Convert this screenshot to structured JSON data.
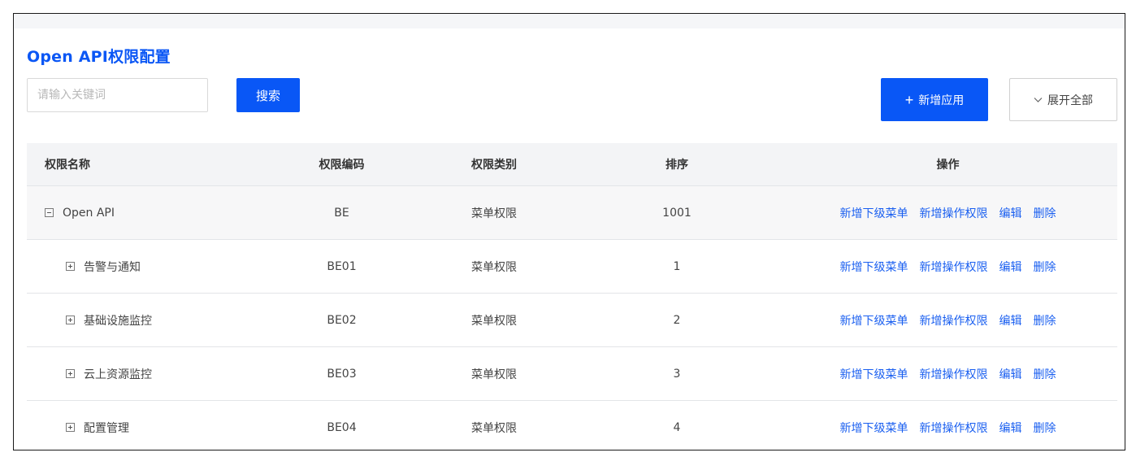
{
  "header": {
    "title": "Open API权限配置",
    "search_placeholder": "请输入关键词",
    "search_value": "",
    "search_button": "搜索",
    "add_button": "新增应用",
    "add_icon": "plus-icon",
    "expand_button": "展开全部",
    "expand_icon": "chevron-down-icon"
  },
  "table": {
    "columns": [
      "权限名称",
      "权限编码",
      "权限类别",
      "排序",
      "操作"
    ],
    "rows": [
      {
        "name": "Open API",
        "code": "BE",
        "type": "菜单权限",
        "sort": "1001",
        "expanded": true,
        "level": 0
      },
      {
        "name": "告警与通知",
        "code": "BE01",
        "type": "菜单权限",
        "sort": "1",
        "expanded": false,
        "level": 1
      },
      {
        "name": "基础设施监控",
        "code": "BE02",
        "type": "菜单权限",
        "sort": "2",
        "expanded": false,
        "level": 1
      },
      {
        "name": "云上资源监控",
        "code": "BE03",
        "type": "菜单权限",
        "sort": "3",
        "expanded": false,
        "level": 1
      },
      {
        "name": "配置管理",
        "code": "BE04",
        "type": "菜单权限",
        "sort": "4",
        "expanded": false,
        "level": 1
      }
    ],
    "actions": [
      "新增下级菜单",
      "新增操作权限",
      "编辑",
      "删除"
    ]
  },
  "colors": {
    "accent": "#0957f6",
    "title": "#0b57f5",
    "link": "#1a5ff0",
    "header_bg": "#f3f4f6"
  }
}
